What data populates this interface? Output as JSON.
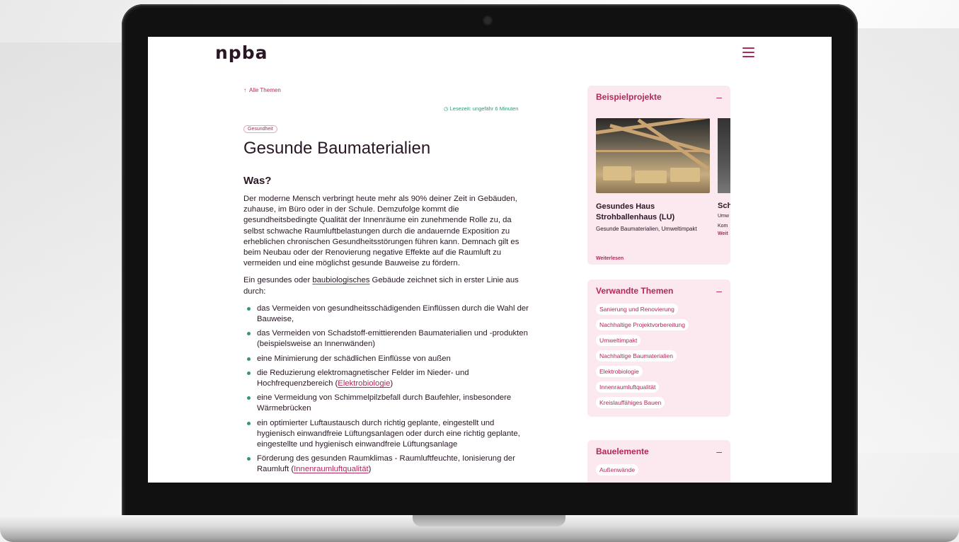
{
  "site": {
    "logo": "npba",
    "menu_icon": "hamburger-menu-icon",
    "accent_color": "#b3275b",
    "secondary_color": "#2e9a6e"
  },
  "article": {
    "back_icon": "arrow-up-icon",
    "back_label": "Alle Themen",
    "reading_icon": "clock-icon",
    "reading_time": "Lesezeit: ungefähr 6 Minuten",
    "tag": "Gesundheit",
    "title": "Gesunde Baumaterialien",
    "section_heading": "Was?",
    "paragraph1": "Der moderne Mensch verbringt heute mehr als 90% deiner Zeit in Gebäuden, zuhause, im Büro oder in der Schule. Demzufolge kommt die gesundheitsbedingte Qualität der Innenräume ein zunehmende Rolle zu, da selbst schwache Raumluftbelastungen durch die andauernde Exposition zu erheblichen chronischen Gesundheitsstörungen führen kann. Demnach gilt es beim Neubau oder der Renovierung negative Effekte auf die Raumluft zu vermeiden und eine möglichst gesunde Bauweise zu fördern.",
    "paragraph2_before": "Ein gesundes oder",
    "paragraph2_link": "baubiologisches",
    "paragraph2_after": "Gebäude zeichnet sich in erster Linie aus durch:",
    "bullets": [
      "das Vermeiden von gesundheitsschädigenden Einflüssen durch die Wahl der Bauweise,",
      "das Vermeiden von Schadstoff-emittierenden Baumaterialien und -produkten (beispielsweise an Innenwänden)",
      "eine Minimierung der schädlichen Einflüsse von außen"
    ],
    "bullet4_before": "die Reduzierung elektromagnetischer Felder im Nieder- und Hochfrequenzbereich (",
    "bullet4_link": "Elektrobiologie",
    "bullet4_after": ")",
    "bullet5": "eine Vermeidung von Schimmelpilzbefall durch Baufehler, insbesondere Wärmebrücken",
    "bullet6": "ein optimierter Luftaustausch durch richtig geplante, eingestellt und hygienisch einwandfreie Lüftungsanlagen oder durch eine richtig geplante, eingestellte und hygienisch einwandfreie Lüftungsanlage",
    "bullet7_before": "Förderung des gesunden Raumklimas - Raumluftfeuchte, Ionisierung der Raumluft (",
    "bullet7_link": "Innenraumluftqualität",
    "bullet7_after": ")"
  },
  "sidebar": {
    "projects": {
      "heading": "Beispielprojekte",
      "toggle": "–",
      "items": [
        {
          "title": "Gesundes Haus Strohballenhaus (LU)",
          "subtitle": "Gesunde Baumaterialien, Umweltimpakt",
          "more": "Weiterlesen"
        },
        {
          "title": "Sch",
          "subtitle_line1": "Umw",
          "subtitle_line2": "Kom",
          "more": "Weit"
        }
      ]
    },
    "related": {
      "heading": "Verwandte Themen",
      "toggle": "–",
      "chips": [
        "Sanierung und Renovierung",
        "Nachhaltige Projektvorbereitung",
        "Umweltimpakt",
        "Nachhaltige Baumaterialien",
        "Elektrobiologie",
        "Innenraumluftqualität",
        "Kreislauffähiges Bauen"
      ]
    },
    "elements": {
      "heading": "Bauelemente",
      "toggle": "–",
      "chips": [
        "Außenwände"
      ]
    }
  }
}
